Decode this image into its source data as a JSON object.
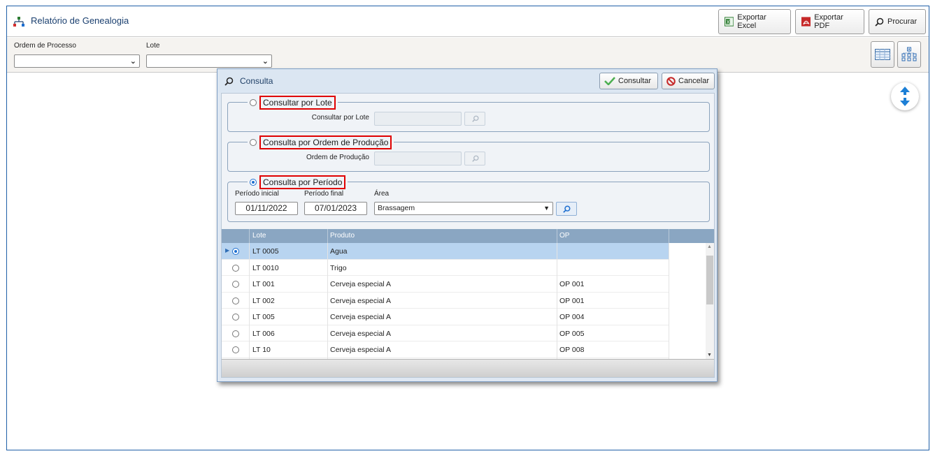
{
  "header": {
    "title": "Relatório de Genealogia",
    "export_excel": "Exportar Excel",
    "export_pdf": "Exportar PDF",
    "search": "Procurar"
  },
  "filters": {
    "ordem_label": "Ordem de Processo",
    "lote_label": "Lote"
  },
  "dialog": {
    "title": "Consulta",
    "consultar_btn": "Consultar",
    "cancelar_btn": "Cancelar",
    "section_lote": {
      "legend": "Consultar por Lote",
      "field_label": "Consultar por Lote",
      "selected": false
    },
    "section_op": {
      "legend": "Consulta por Ordem de Produção",
      "field_label": "Ordem de Produção",
      "selected": false
    },
    "section_periodo": {
      "legend": "Consulta por Período",
      "selected": true,
      "inicio_label": "Período inicial",
      "fim_label": "Período final",
      "area_label": "Área",
      "inicio_value": "01/11/2022",
      "fim_value": "07/01/2023",
      "area_value": "Brassagem"
    },
    "grid": {
      "columns": [
        "Lote",
        "Produto",
        "OP"
      ],
      "rows": [
        {
          "lote": "LT 0005",
          "produto": "Agua",
          "op": ""
        },
        {
          "lote": "LT 0010",
          "produto": "Trigo",
          "op": ""
        },
        {
          "lote": "LT 001",
          "produto": "Cerveja especial A",
          "op": "OP 001"
        },
        {
          "lote": "LT 002",
          "produto": "Cerveja especial A",
          "op": "OP 001"
        },
        {
          "lote": "LT 005",
          "produto": "Cerveja especial A",
          "op": "OP 004"
        },
        {
          "lote": "LT 006",
          "produto": "Cerveja especial A",
          "op": "OP 005"
        },
        {
          "lote": "LT 10",
          "produto": "Cerveja especial A",
          "op": "OP 008"
        }
      ]
    }
  },
  "colors": {
    "accent": "#1e6fd0",
    "highlight_box": "#e00000",
    "selected_row": "#b8d4f0"
  }
}
